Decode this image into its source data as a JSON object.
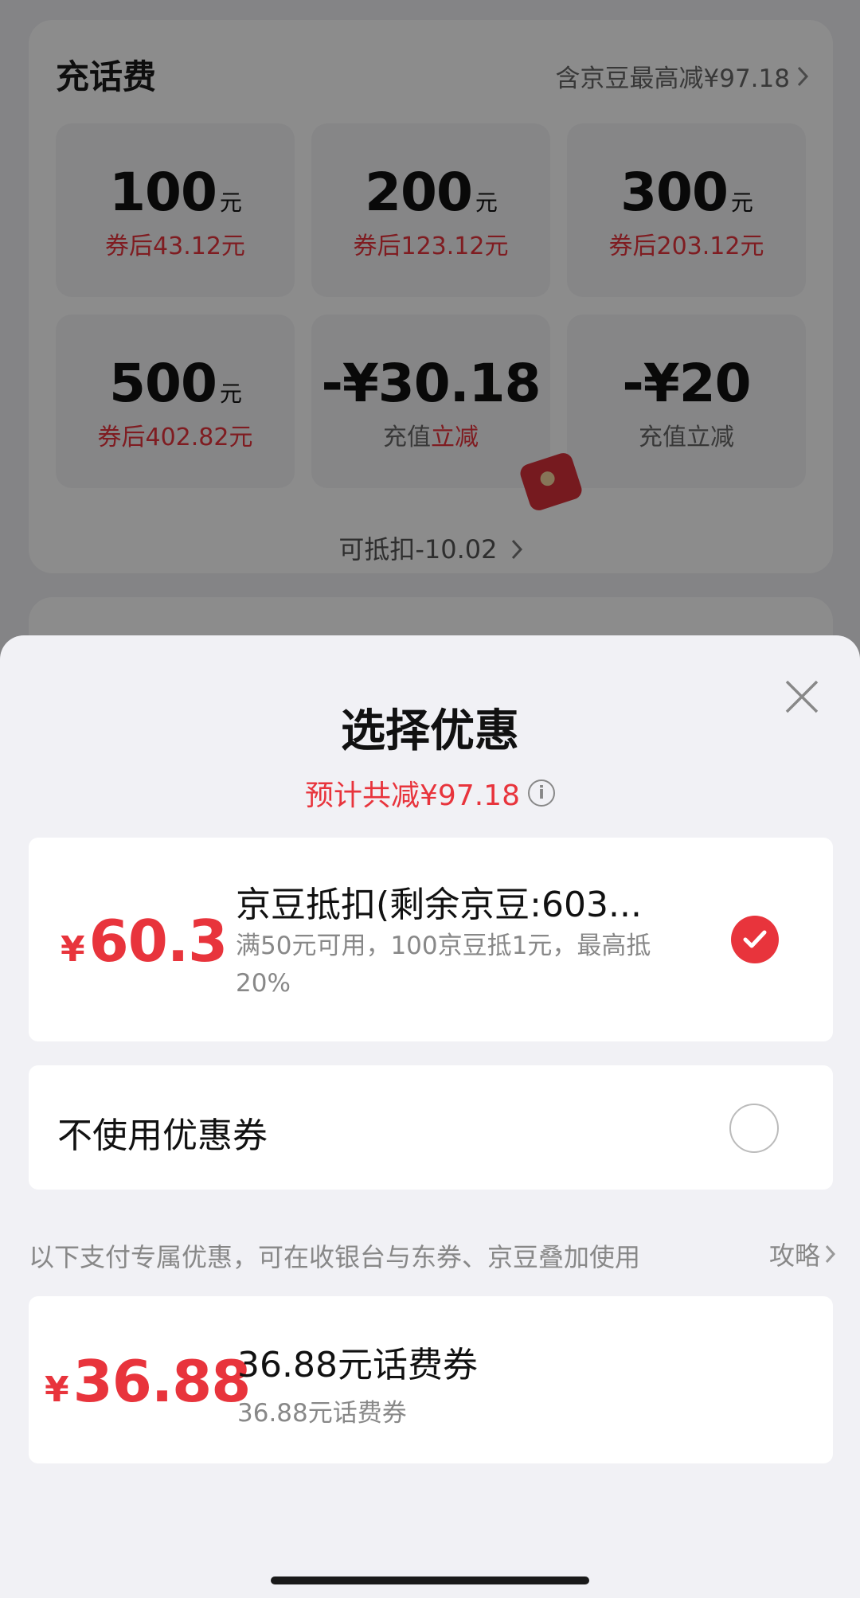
{
  "recharge": {
    "title": "充话费",
    "promo": "含京豆最高减¥97.18",
    "tiles": [
      {
        "amount": "100",
        "unit": "元",
        "sub": "券后43.12元"
      },
      {
        "amount": "200",
        "unit": "元",
        "sub": "券后123.12元"
      },
      {
        "amount": "300",
        "unit": "元",
        "sub": "券后203.12元"
      },
      {
        "amount": "500",
        "unit": "元",
        "sub": "券后402.82元"
      },
      {
        "amount": "-¥30.18",
        "sub_prefix": "充值",
        "sub_red": "立减"
      },
      {
        "amount": "-¥20",
        "sub": "充值立减"
      }
    ],
    "deduct": "可抵扣-10.02"
  },
  "sheet": {
    "title": "选择优惠",
    "subtitle": "预计共减¥97.18",
    "options": [
      {
        "symbol": "¥",
        "price": "60.3",
        "title": "京豆抵扣(剩余京豆:603...",
        "desc": "满50元可用，100京豆抵1元，最高抵20%",
        "selected": true
      },
      {
        "title": "不使用优惠券",
        "selected": false
      }
    ],
    "note": "以下支付专属优惠，可在收银台与东券、京豆叠加使用",
    "strategy": "攻略",
    "pay_coupon": {
      "symbol": "¥",
      "price": "36.88",
      "title": "36.88元话费券",
      "desc": "36.88元话费券"
    }
  },
  "colors": {
    "accent_red": "#e8343c",
    "overlay": "rgba(0,0,0,0.45)"
  }
}
